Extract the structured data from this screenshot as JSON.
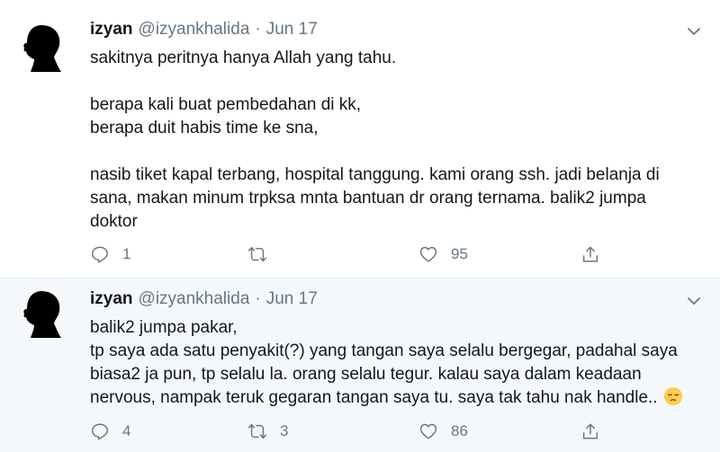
{
  "tweets": [
    {
      "name": "izyan",
      "handle": "@izyankhalida",
      "dot": "·",
      "date": "Jun 17",
      "lines": [
        "sakitnya peritnya hanya Allah yang tahu.",
        "",
        "berapa kali buat pembedahan di kk,",
        "berapa duit habis time ke sna,",
        "",
        "nasib tiket kapal terbang,  hospital tanggung.  kami orang ssh.  jadi belanja di",
        "sana,  makan minum trpksa mnta bantuan dr orang ternama.  balik2 jumpa",
        "doktor"
      ],
      "reply_count": "1",
      "retweet_count": "",
      "like_count": "95"
    },
    {
      "name": "izyan",
      "handle": "@izyankhalida",
      "dot": "·",
      "date": "Jun 17",
      "lines": [
        "balik2 jumpa pakar,",
        "tp saya ada satu penyakit(?) yang tangan saya selalu bergegar,  padahal saya",
        "biasa2 ja pun,  tp selalu la.  orang selalu tegur.  kalau saya dalam keadaan",
        "nervous, nampak teruk gegaran tangan saya tu.  saya tak tahu nak handle.."
      ],
      "emoji": "pensive-face-emoji",
      "reply_count": "4",
      "retweet_count": "3",
      "like_count": "86"
    }
  ],
  "icons": {
    "reply": "reply-icon",
    "retweet": "retweet-icon",
    "like": "heart-icon",
    "share": "share-icon",
    "caret": "chevron-down-icon"
  },
  "colors": {
    "text": "#14171a",
    "secondary": "#657786",
    "divider": "#e6ecf0",
    "highlight_bg": "#f5f8fa"
  }
}
